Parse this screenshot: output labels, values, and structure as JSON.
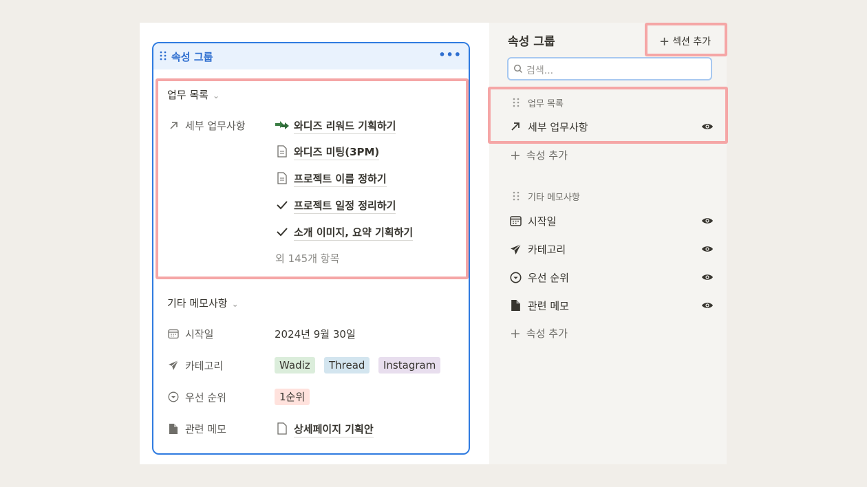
{
  "card": {
    "title": "속성 그룹",
    "more": "•••",
    "sections": [
      {
        "label": "업무 목록",
        "property": {
          "name": "세부 업무사항",
          "icon": "arrow-up-right-icon",
          "items": [
            {
              "text": "와디즈 리워드 기획하기",
              "icon": "green-arrows-icon"
            },
            {
              "text": "와디즈 미팅(3PM)",
              "icon": "page-icon"
            },
            {
              "text": "프로젝트 이름 정하기",
              "icon": "page-icon"
            },
            {
              "text": "프로젝트 일정 정리하기",
              "icon": "check-icon"
            },
            {
              "text": "소개 이미지, 요약 기획하기",
              "icon": "check-icon"
            }
          ],
          "more": "외 145개 항목"
        }
      },
      {
        "label": "기타 메모사항",
        "properties": [
          {
            "name": "시작일",
            "icon": "calendar-icon",
            "value": "2024년 9월 30일"
          },
          {
            "name": "카테고리",
            "icon": "send-icon",
            "tags": [
              {
                "text": "Wadiz",
                "color": "#dbeddb"
              },
              {
                "text": "Thread",
                "color": "#d3e5ef"
              },
              {
                "text": "Instagram",
                "color": "#e8deee"
              }
            ]
          },
          {
            "name": "우선 순위",
            "icon": "circle-chevron-icon",
            "tags": [
              {
                "text": "1순위",
                "color": "#ffe2dd"
              }
            ]
          },
          {
            "name": "관련 메모",
            "icon": "document-icon",
            "relation": {
              "text": "상세페이지 기획안",
              "icon": "page-icon"
            }
          }
        ]
      }
    ]
  },
  "panel": {
    "title": "속성 그룹",
    "add_section": "섹션 추가",
    "search_placeholder": "검색...",
    "groups": [
      {
        "label": "업무 목록",
        "items": [
          {
            "label": "세부 업무사항",
            "icon": "arrow-up-right-icon",
            "visible": true
          }
        ],
        "add_label": "속성 추가"
      },
      {
        "label": "기타 메모사항",
        "items": [
          {
            "label": "시작일",
            "icon": "calendar-icon",
            "visible": true
          },
          {
            "label": "카테고리",
            "icon": "send-icon",
            "visible": true
          },
          {
            "label": "우선 순위",
            "icon": "circle-chevron-icon",
            "visible": true
          },
          {
            "label": "관련 메모",
            "icon": "document-icon",
            "visible": true
          }
        ],
        "add_label": "속성 추가"
      }
    ]
  },
  "colors": {
    "accent": "#2f7be0",
    "highlight": "#f5a6a6",
    "panel_bg": "#f5f4f1",
    "page_bg": "#f1eee9"
  }
}
